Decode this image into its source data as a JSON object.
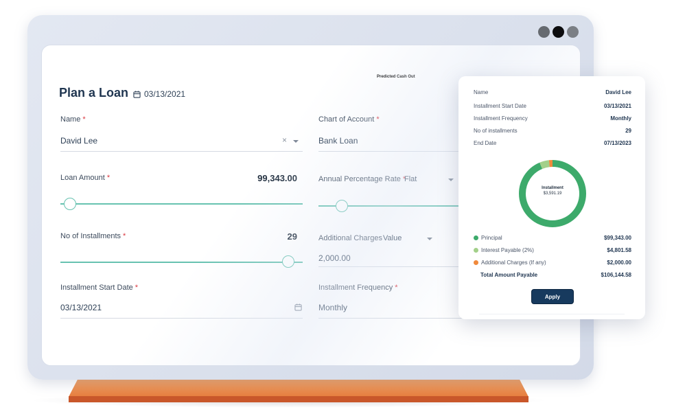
{
  "form": {
    "title": "Plan a Loan",
    "date": "03/13/2021",
    "predicted_cash_out": "Predicted Cash Out",
    "required_mark": "*",
    "name": {
      "label": "Name",
      "value": "David Lee"
    },
    "chart_of_account": {
      "label": "Chart of Account",
      "value": "Bank Loan"
    },
    "loan_amount": {
      "label": "Loan Amount",
      "value": "99,343.00",
      "slider_level": 0.04
    },
    "apr": {
      "label": "Annual Percentage Rate",
      "type": "Flat",
      "slider_level": 0.16
    },
    "installments": {
      "label": "No of Installments",
      "value": "29",
      "slider_level": 0.94
    },
    "additional_charges": {
      "label": "Additional Charges",
      "type": "Value",
      "value": "2,000.00"
    },
    "start_date": {
      "label": "Installment Start Date",
      "value": "03/13/2021"
    },
    "frequency": {
      "label": "Installment Frequency",
      "value": "Monthly"
    }
  },
  "summary": {
    "rows": [
      {
        "key": "Name",
        "value": "David Lee"
      },
      {
        "key": "Installment Start Date",
        "value": "03/13/2021"
      },
      {
        "key": "Installment Frequency",
        "value": "Monthly"
      },
      {
        "key": "No of installments",
        "value": "29"
      },
      {
        "key": "End Date",
        "value": "07/13/2023"
      }
    ],
    "donut": {
      "label": "Installment",
      "value": "$3,591.19",
      "segments": [
        {
          "name": "Principal",
          "amount": 99343.0,
          "color": "#3daa6b"
        },
        {
          "name": "Interest Payable (2%)",
          "amount": 4801.58,
          "color": "#a3d08a"
        },
        {
          "name": "Additional Charges (If any)",
          "amount": 2000.0,
          "color": "#f08a3c"
        }
      ]
    },
    "legend": [
      {
        "key": "Principal",
        "value": "$99,343.00",
        "color": "#3daa6b"
      },
      {
        "key": "Interest Payable (2%)",
        "value": "$4,801.58",
        "color": "#a3d08a"
      },
      {
        "key": "Additional Charges (If any)",
        "value": "$2,000.00",
        "color": "#f08a3c"
      }
    ],
    "total": {
      "key": "Total Amount Payable",
      "value": "$106,144.58"
    },
    "apply_label": "Apply"
  }
}
